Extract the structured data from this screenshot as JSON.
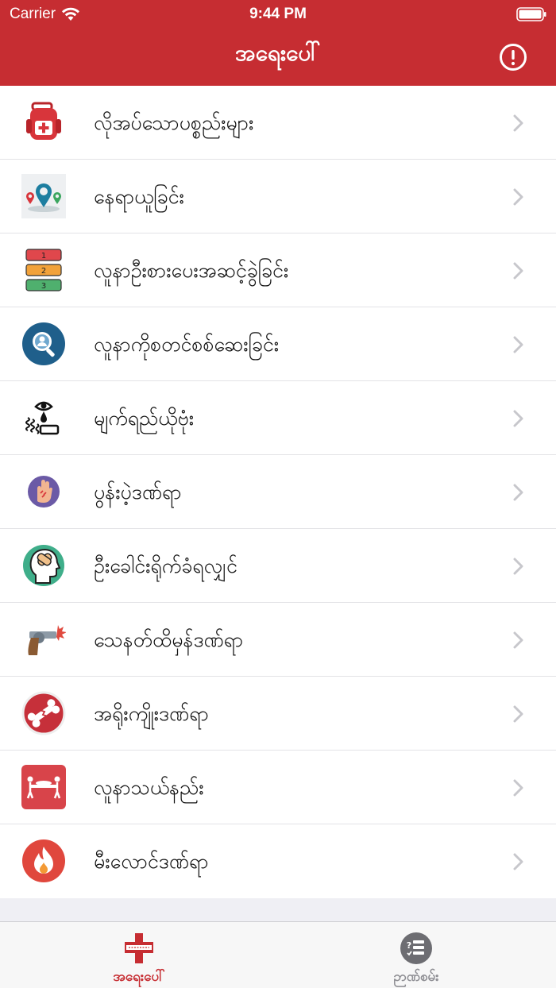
{
  "status_bar": {
    "carrier": "Carrier",
    "time": "9:44 PM"
  },
  "header": {
    "title": "အရေးပေါ်",
    "info_icon": "info-circle-icon"
  },
  "menu": [
    {
      "label": "လိုအပ်သောပစ္စည်းများ",
      "icon": "first-aid-backpack-icon"
    },
    {
      "label": "နေရာယူခြင်း",
      "icon": "location-pins-icon"
    },
    {
      "label": "လူနာဦးစားပေးအဆင့်ခွဲခြင်း",
      "icon": "triage-levels-icon"
    },
    {
      "label": "လူနာကိုစတင်စစ်ဆေးခြင်း",
      "icon": "patient-search-icon"
    },
    {
      "label": "မျက်ရည်ယိုဗုံး",
      "icon": "tear-gas-icon"
    },
    {
      "label": "ပွန်းပဲ့ဒဏ်ရာ",
      "icon": "abrasion-hand-icon"
    },
    {
      "label": "ဦးခေါင်းရိုက်ခံရလျှင်",
      "icon": "head-injury-icon"
    },
    {
      "label": "သေနတ်ထိမှန်ဒဏ်ရာ",
      "icon": "gunshot-icon"
    },
    {
      "label": "အရိုးကျိုးဒဏ်ရာ",
      "icon": "broken-bone-icon"
    },
    {
      "label": "လူနာသယ်နည်း",
      "icon": "stretcher-carry-icon"
    },
    {
      "label": "မီးလောင်ဒဏ်ရာ",
      "icon": "burn-fire-icon"
    }
  ],
  "tabs": [
    {
      "label": "အရေးပေါ်",
      "icon": "red-cross-icon",
      "active": true,
      "color": "#c62d32"
    },
    {
      "label": "ဉာဏ်စမ်း",
      "icon": "quiz-list-icon",
      "active": false,
      "color": "#8e8e93"
    }
  ],
  "colors": {
    "accent": "#c62d32",
    "chevron": "#c7c7cc"
  }
}
